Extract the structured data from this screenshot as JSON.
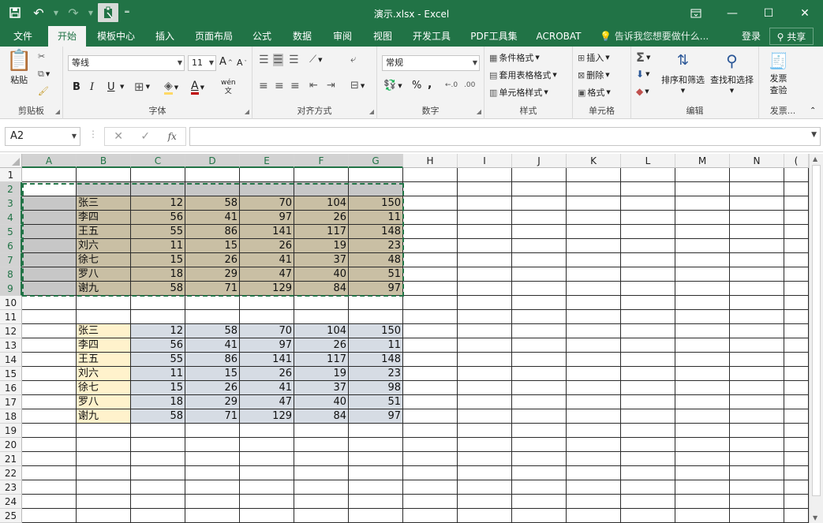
{
  "window": {
    "title": "演示.xlsx - Excel",
    "qat": {
      "save_icon": "save-icon",
      "undo_icon": "undo-icon",
      "redo_icon": "redo-icon",
      "paste_icon": "paste-icon",
      "customize_icon": "customize-qat-icon"
    },
    "controls": [
      "ribbon-display-icon",
      "minimize-icon",
      "maximize-icon",
      "close-icon"
    ],
    "accent": "#217346"
  },
  "tabs": [
    "文件",
    "开始",
    "模板中心",
    "插入",
    "页面布局",
    "公式",
    "数据",
    "审阅",
    "视图",
    "开发工具",
    "PDF工具集",
    "ACROBAT"
  ],
  "active_tab": "开始",
  "tell_me": "告诉我您想要做什么...",
  "login": "登录",
  "share": "共享",
  "ribbon": {
    "clipboard": {
      "label": "剪贴板",
      "paste": "粘贴"
    },
    "font": {
      "label": "字体",
      "font_name": "等线",
      "font_size": "11",
      "bold": "B",
      "italic": "I",
      "underline": "U",
      "grow": "A",
      "shrink": "A",
      "wen": "wén"
    },
    "alignment": {
      "label": "对齐方式"
    },
    "number": {
      "label": "数字",
      "format": "常规",
      "percent": "%",
      "comma": ","
    },
    "styles": {
      "label": "样式",
      "conditional": "条件格式",
      "table": "套用表格格式",
      "cell_styles": "单元格样式"
    },
    "cells": {
      "label": "单元格",
      "insert": "插入",
      "delete": "删除",
      "format": "格式"
    },
    "editing": {
      "label": "编辑",
      "sort": "排序和筛选",
      "find": "查找和选择"
    },
    "invoice": {
      "label": "发票...",
      "check_line1": "发票",
      "check_line2": "查验"
    }
  },
  "formula_bar": {
    "name_box": "A2",
    "formula": "",
    "fx": "fx"
  },
  "columns": [
    "A",
    "B",
    "C",
    "D",
    "E",
    "F",
    "G",
    "H",
    "I",
    "J",
    "K",
    "L",
    "M",
    "N",
    "("
  ],
  "rows": [
    "1",
    "2",
    "3",
    "4",
    "5",
    "6",
    "7",
    "8",
    "9",
    "10",
    "11",
    "12",
    "13",
    "14",
    "15",
    "16",
    "17",
    "18",
    "19",
    "20",
    "21",
    "22",
    "23",
    "24",
    "25"
  ],
  "table1": {
    "names": [
      "张三",
      "李四",
      "王五",
      "刘六",
      "徐七",
      "罗八",
      "谢九"
    ],
    "values": [
      [
        "12",
        "58",
        "70",
        "104",
        "150"
      ],
      [
        "56",
        "41",
        "97",
        "26",
        "11"
      ],
      [
        "55",
        "86",
        "141",
        "117",
        "148"
      ],
      [
        "11",
        "15",
        "26",
        "19",
        "23"
      ],
      [
        "15",
        "26",
        "41",
        "37",
        "48"
      ],
      [
        "18",
        "29",
        "47",
        "40",
        "51"
      ],
      [
        "58",
        "71",
        "129",
        "84",
        "97"
      ]
    ]
  },
  "table2": {
    "names": [
      "张三",
      "李四",
      "王五",
      "刘六",
      "徐七",
      "罗八",
      "谢九"
    ],
    "values": [
      [
        "12",
        "58",
        "70",
        "104",
        "150"
      ],
      [
        "56",
        "41",
        "97",
        "26",
        "11"
      ],
      [
        "55",
        "86",
        "141",
        "117",
        "148"
      ],
      [
        "11",
        "15",
        "26",
        "19",
        "23"
      ],
      [
        "15",
        "26",
        "41",
        "37",
        "98"
      ],
      [
        "18",
        "29",
        "47",
        "40",
        "51"
      ],
      [
        "58",
        "71",
        "129",
        "84",
        "97"
      ]
    ]
  },
  "colors": {
    "table1_header_fill": "#c7c7c7",
    "table1_data_fill": "#c9bfa4",
    "table1_colA_fill": "#c7c7c7",
    "table2_name_fill": "#fff2cc",
    "table2_data_fill": "#d6dce4"
  }
}
